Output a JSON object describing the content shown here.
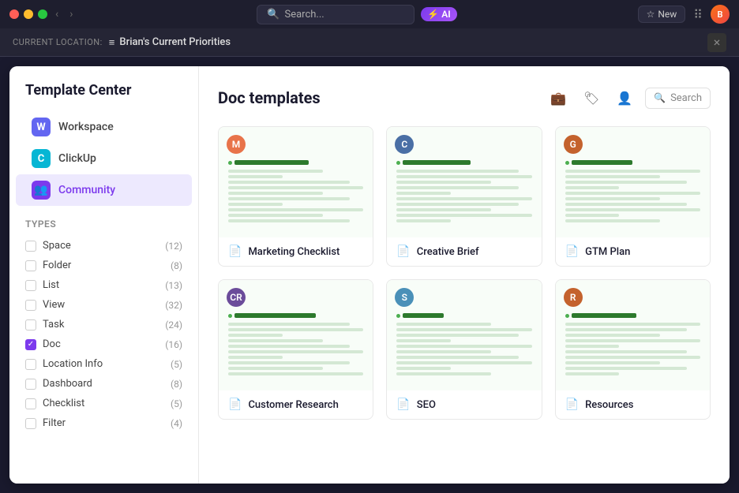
{
  "topbar": {
    "search_placeholder": "Search...",
    "ai_label": "AI",
    "new_label": "New",
    "avatar_initials": "B"
  },
  "location_bar": {
    "current_label": "CURRENT LOCATION:",
    "location_name": "Brian's Current Priorities",
    "close_label": "×"
  },
  "sidebar": {
    "title": "Template Center",
    "nav_items": [
      {
        "id": "workspace",
        "label": "Workspace",
        "icon": "W",
        "icon_class": "nav-icon-w",
        "active": false
      },
      {
        "id": "clickup",
        "label": "ClickUp",
        "icon": "C",
        "icon_class": "nav-icon-c",
        "active": false
      },
      {
        "id": "community",
        "label": "Community",
        "icon": "👥",
        "icon_class": "nav-icon-comm",
        "active": true
      }
    ],
    "types_label": "Types",
    "types": [
      {
        "id": "space",
        "label": "Space",
        "count": "(12)",
        "checked": false
      },
      {
        "id": "folder",
        "label": "Folder",
        "count": "(8)",
        "checked": false
      },
      {
        "id": "list",
        "label": "List",
        "count": "(13)",
        "checked": false
      },
      {
        "id": "view",
        "label": "View",
        "count": "(32)",
        "checked": false
      },
      {
        "id": "task",
        "label": "Task",
        "count": "(24)",
        "checked": false
      },
      {
        "id": "doc",
        "label": "Doc",
        "count": "(16)",
        "checked": true
      },
      {
        "id": "location-info",
        "label": "Location Info",
        "count": "(5)",
        "checked": false
      },
      {
        "id": "dashboard",
        "label": "Dashboard",
        "count": "(8)",
        "checked": false
      },
      {
        "id": "checklist",
        "label": "Checklist",
        "count": "(5)",
        "checked": false
      },
      {
        "id": "filter",
        "label": "Filter",
        "count": "(4)",
        "checked": false
      }
    ]
  },
  "main": {
    "title": "Doc templates",
    "search_placeholder": "Search",
    "templates": [
      {
        "id": "marketing-checklist",
        "name": "Marketing Checklist",
        "avatar_color": "#e8734a",
        "avatar_initials": "M",
        "title_color": "#2d7a2d"
      },
      {
        "id": "creative-brief",
        "name": "Creative Brief",
        "avatar_color": "#4a6fa5",
        "avatar_initials": "C",
        "title_color": "#2d7a2d"
      },
      {
        "id": "gtm-plan",
        "name": "GTM Plan",
        "avatar_color": "#c4622d",
        "avatar_initials": "G",
        "title_color": "#2d7a2d"
      },
      {
        "id": "customer-research",
        "name": "Customer Research",
        "avatar_color": "#6b4c9a",
        "avatar_initials": "CR",
        "title_color": "#2d7a2d"
      },
      {
        "id": "seo",
        "name": "SEO",
        "avatar_color": "#4a90b8",
        "avatar_initials": "S",
        "title_color": "#2d7a2d"
      },
      {
        "id": "resources",
        "name": "Resources",
        "avatar_color": "#c4622d",
        "avatar_initials": "R",
        "title_color": "#2d7a2d"
      }
    ]
  }
}
